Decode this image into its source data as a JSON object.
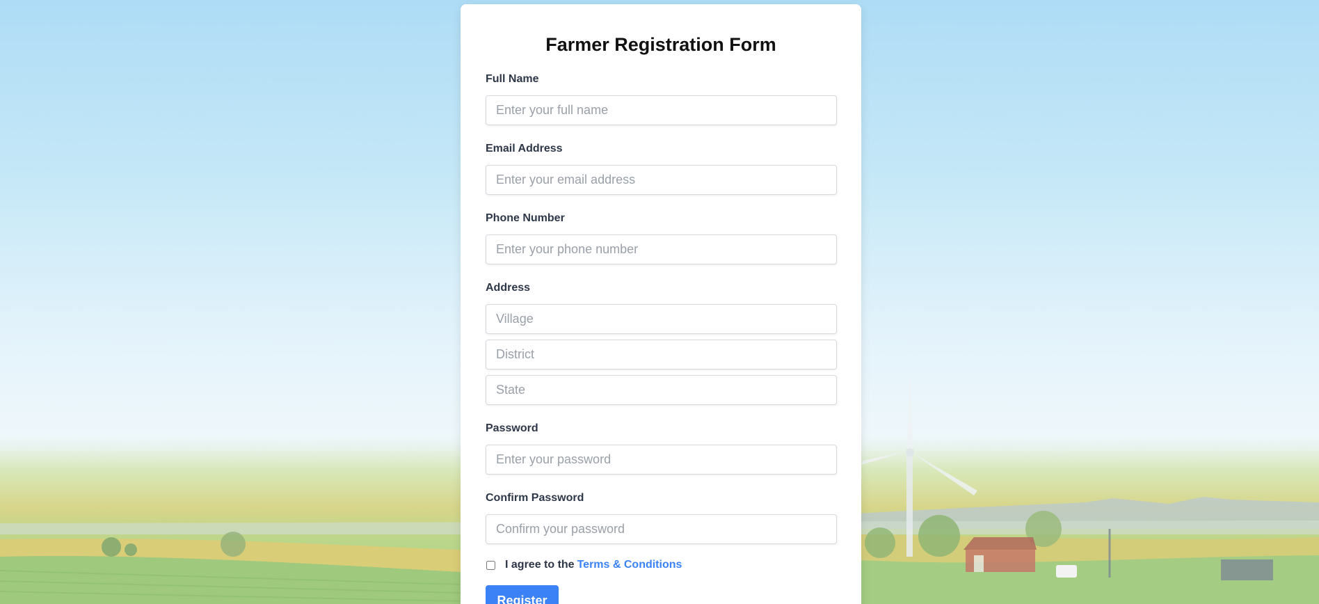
{
  "form": {
    "title": "Farmer Registration Form",
    "full_name": {
      "label": "Full Name",
      "placeholder": "Enter your full name"
    },
    "email": {
      "label": "Email Address",
      "placeholder": "Enter your email address"
    },
    "phone": {
      "label": "Phone Number",
      "placeholder": "Enter your phone number"
    },
    "address": {
      "label": "Address",
      "village_placeholder": "Village",
      "district_placeholder": "District",
      "state_placeholder": "State"
    },
    "password": {
      "label": "Password",
      "placeholder": "Enter your password"
    },
    "confirm_password": {
      "label": "Confirm Password",
      "placeholder": "Confirm your password"
    },
    "terms": {
      "text": "I agree to the",
      "link": "Terms & Conditions",
      "checked": false
    },
    "submit_label": "Register"
  },
  "colors": {
    "accent": "#3b82f6",
    "label_text": "#2d3748",
    "card_background": "#ffffff"
  },
  "background": {
    "scene": "farm-landscape",
    "elements": [
      "sky",
      "wind-turbine",
      "barn",
      "trees",
      "crop-fields",
      "hills"
    ]
  }
}
